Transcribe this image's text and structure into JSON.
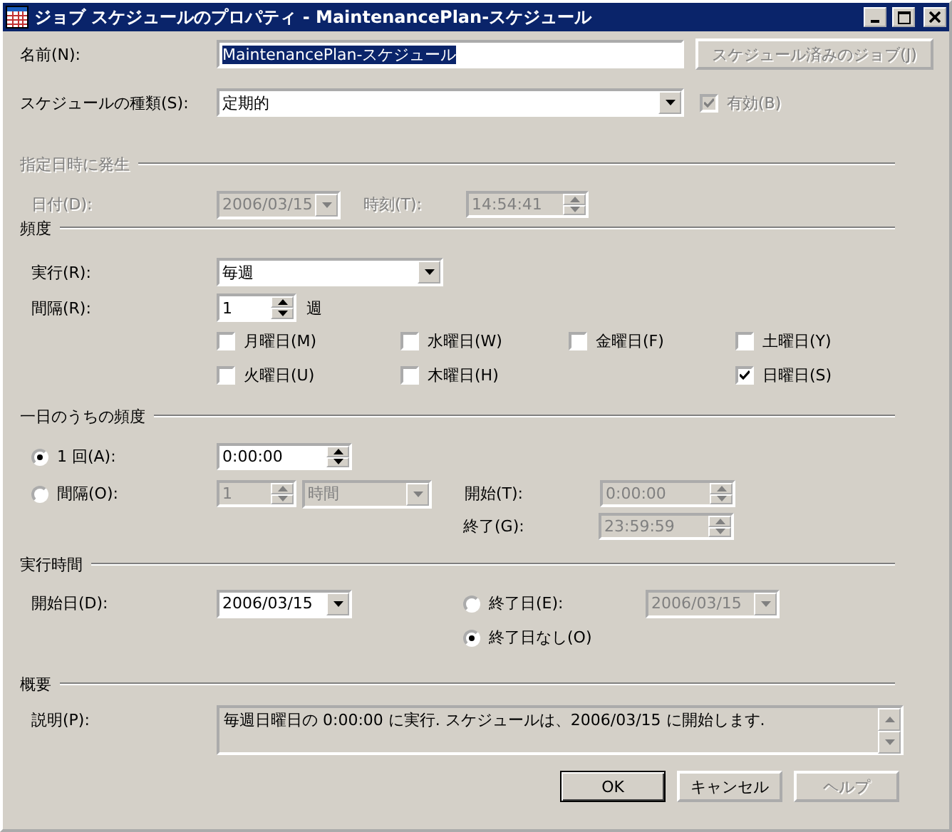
{
  "window": {
    "title": "ジョブ スケジュールのプロパティ - MaintenancePlan-スケジュール"
  },
  "name": {
    "label": "名前(N):",
    "value": "MaintenancePlan-スケジュール",
    "highlighted": true
  },
  "scheduled_jobs_button": {
    "label": "スケジュール済みのジョブ(J)",
    "disabled": true
  },
  "schedule_type": {
    "label": "スケジュールの種類(S):",
    "value": "定期的"
  },
  "enabled": {
    "label": "有効(B)",
    "checked": true,
    "disabled": true
  },
  "one_time": {
    "title": "指定日時に発生",
    "disabled": true,
    "date_label": "日付(D):",
    "date": "2006/03/15",
    "time_label": "時刻(T):",
    "time": "14:54:41"
  },
  "frequency": {
    "title": "頻度",
    "run_label": "実行(R):",
    "run_value": "毎週",
    "interval_label": "間隔(R):",
    "interval": "1",
    "interval_unit": "週",
    "days": [
      {
        "label": "月曜日(M)",
        "checked": false
      },
      {
        "label": "水曜日(W)",
        "checked": false
      },
      {
        "label": "金曜日(F)",
        "checked": false
      },
      {
        "label": "土曜日(Y)",
        "checked": false
      },
      {
        "label": "火曜日(U)",
        "checked": false
      },
      {
        "label": "木曜日(H)",
        "checked": false
      },
      {
        "label": "日曜日(S)",
        "checked": true
      }
    ]
  },
  "daily": {
    "title": "一日のうちの頻度",
    "options": [
      {
        "label": "1 回(A):",
        "selected": true
      },
      {
        "label": "間隔(O):",
        "selected": false
      }
    ],
    "once_time": "0:00:00",
    "interval_value": "1",
    "interval_unit": "時間",
    "start_label": "開始(T):",
    "start": "0:00:00",
    "end_label": "終了(G):",
    "end": "23:59:59"
  },
  "duration": {
    "title": "実行時間",
    "start_label": "開始日(D):",
    "start_date": "2006/03/15",
    "end_options": [
      {
        "label": "終了日(E):",
        "selected": false
      },
      {
        "label": "終了日なし(O)",
        "selected": true
      }
    ],
    "end_date": "2006/03/15"
  },
  "summary": {
    "title": "概要",
    "label": "説明(P):",
    "text": "毎週日曜日の 0:00:00 に実行. スケジュールは、2006/03/15 に開始します."
  },
  "buttons": [
    {
      "label": "OK",
      "disabled": false,
      "default": true
    },
    {
      "label": "キャンセル",
      "disabled": false,
      "default": false
    },
    {
      "label": "ヘルプ",
      "disabled": true,
      "default": false
    }
  ]
}
